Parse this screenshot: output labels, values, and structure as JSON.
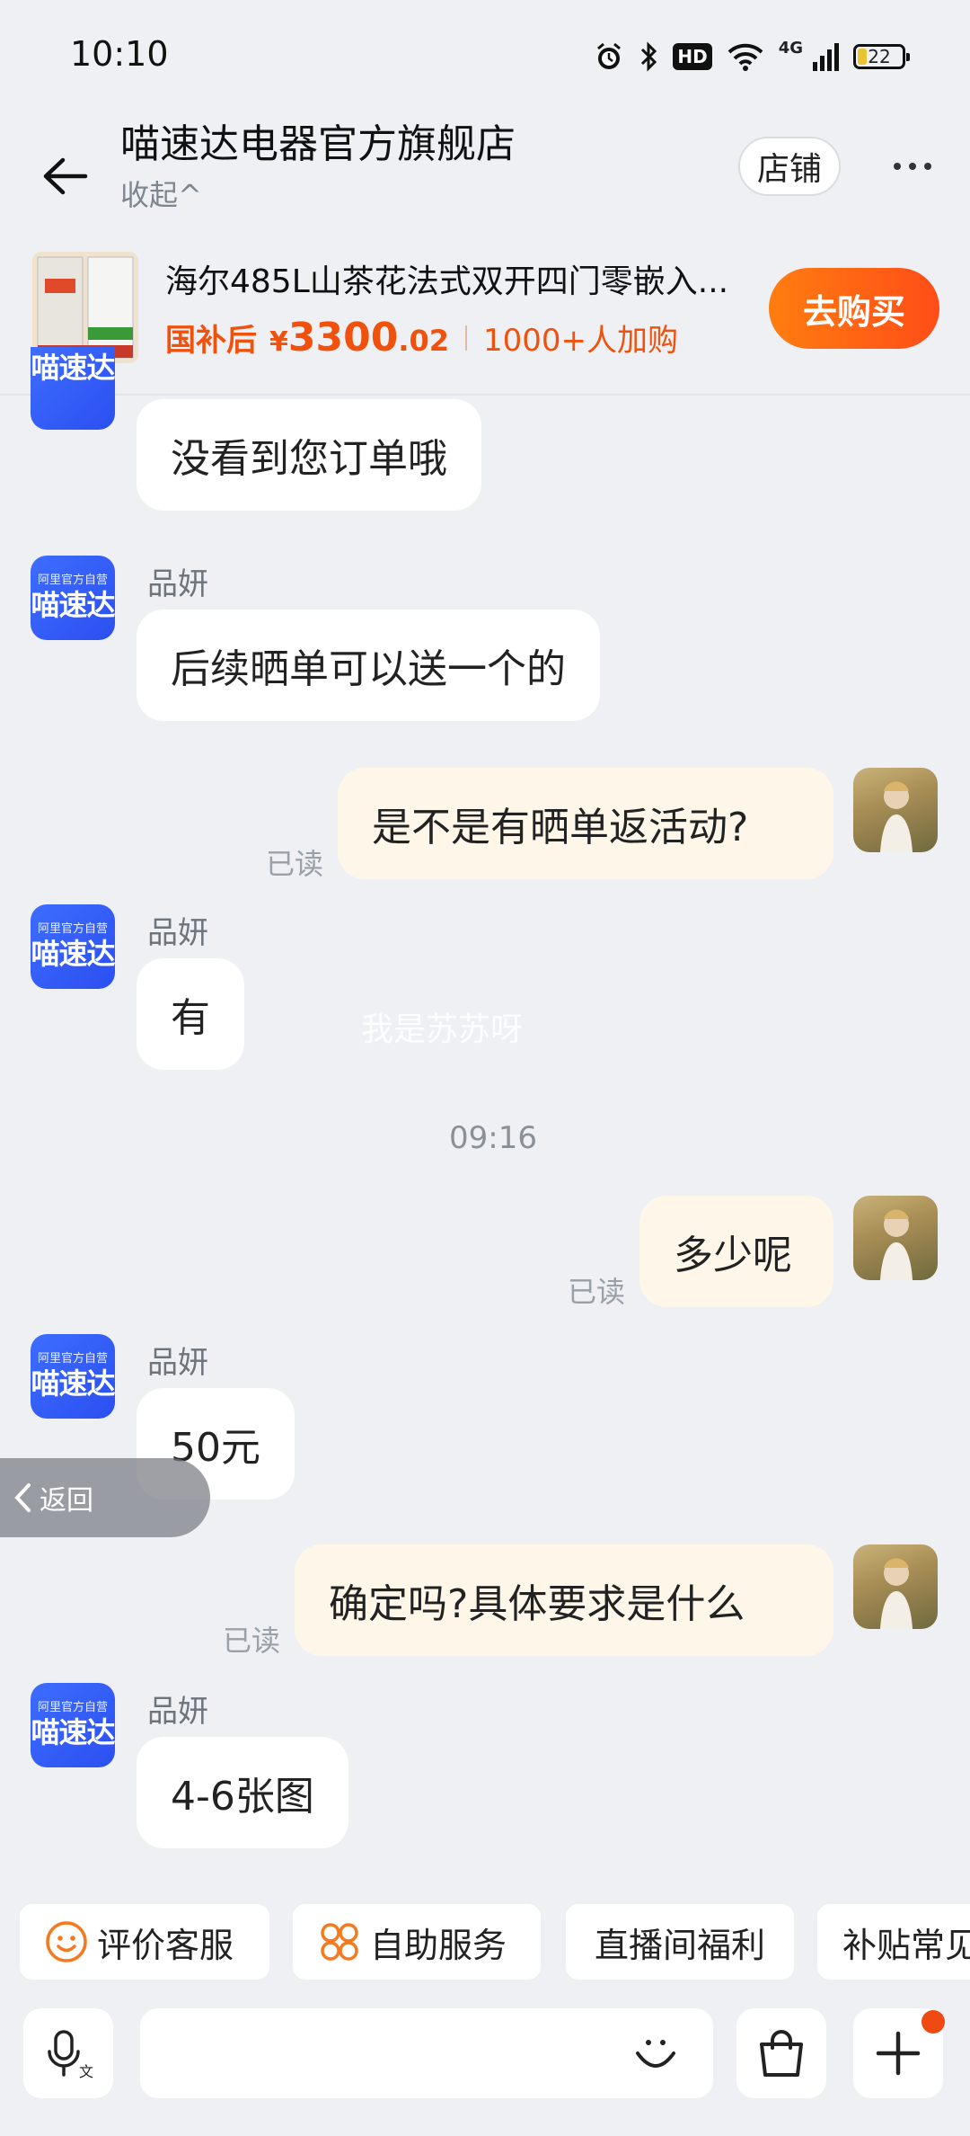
{
  "status_bar": {
    "time": "10:10",
    "hd": "HD",
    "network": "4G",
    "battery": "22"
  },
  "header": {
    "title": "喵速达电器官方旗舰店",
    "collapse_label": "收起^",
    "store_button": "店铺"
  },
  "product": {
    "name": "海尔485L山茶花法式双开四门零嵌入...",
    "price_label": "国补后",
    "currency": "¥",
    "price_int": "3300",
    "price_dec": ".02",
    "buyers": "1000+人加购",
    "buy_button": "去购买"
  },
  "shop_avatar": {
    "top_text": "阿里官方自营",
    "main_text": "喵速达"
  },
  "messages": [
    {
      "side": "left",
      "text": "没看到您订单哦"
    },
    {
      "side": "left",
      "sender": "品妍",
      "text": "后续晒单可以送一个的"
    },
    {
      "side": "right",
      "text": "是不是有晒单返活动?",
      "status": "已读"
    },
    {
      "side": "left",
      "sender": "品妍",
      "text": "有"
    },
    {
      "side": "right",
      "text": "多少呢",
      "status": "已读"
    },
    {
      "side": "left",
      "sender": "品妍",
      "text": "50元"
    },
    {
      "side": "right",
      "text": "确定吗?具体要求是什么",
      "status": "已读"
    },
    {
      "side": "left",
      "sender": "品妍",
      "text": "4-6张图"
    }
  ],
  "time_separator": "09:16",
  "watermark": "我是苏苏呀",
  "float_back_label": "返回",
  "quick_actions": [
    "评价客服",
    "自助服务",
    "直播间福利",
    "补贴常见"
  ],
  "input_bar": {
    "voice_icon": "mic-icon",
    "emoji_icon": "smile-icon",
    "bag_icon": "shopping-bag-icon",
    "plus_icon": "plus-icon"
  }
}
